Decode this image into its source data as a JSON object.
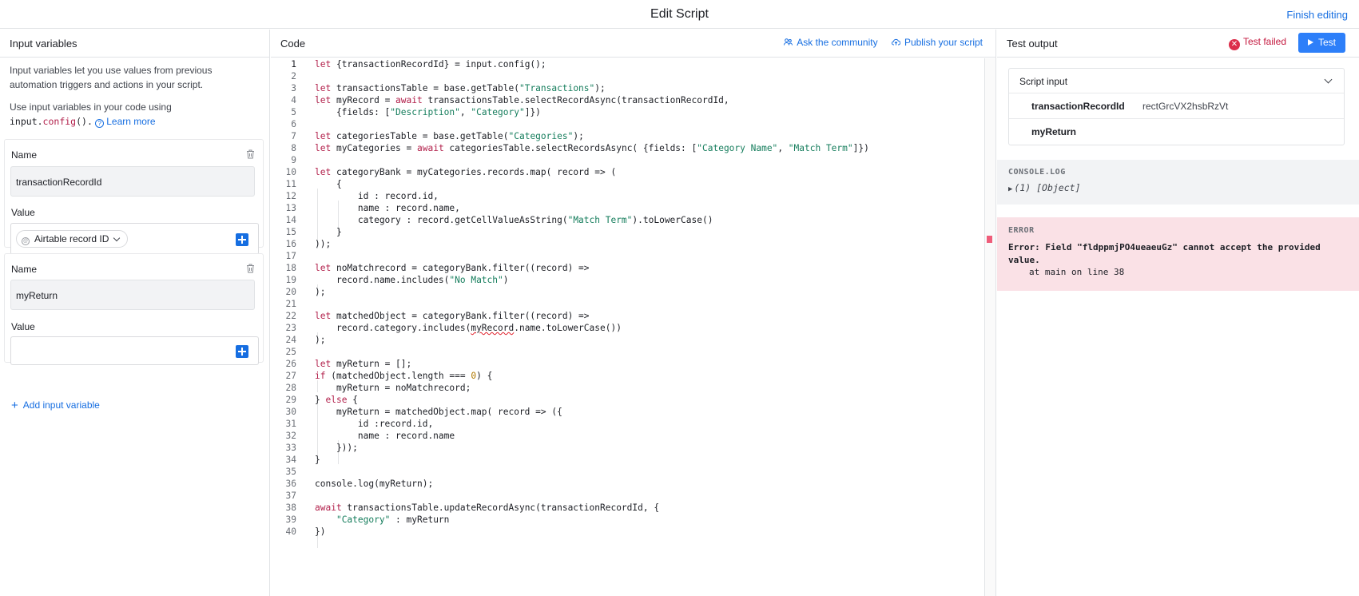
{
  "header": {
    "title": "Edit Script",
    "finish_label": "Finish editing"
  },
  "left": {
    "title": "Input variables",
    "intro1": "Input variables let you use values from previous automation triggers and actions in your script.",
    "intro2_prefix": "Use input variables in your code using",
    "intro2_code_a": "input.",
    "intro2_code_b": "config",
    "intro2_code_c": "().",
    "learn_more": "Learn more",
    "variables": [
      {
        "name_label": "Name",
        "name_value": "transactionRecordId",
        "value_label": "Value",
        "value_pill": "Airtable record ID"
      },
      {
        "name_label": "Name",
        "name_value": "myReturn",
        "value_label": "Value",
        "value_pill": ""
      }
    ],
    "add_variable": "Add input variable"
  },
  "code": {
    "title": "Code",
    "ask_label": "Ask the community",
    "publish_label": "Publish your script",
    "lines": [
      "let {transactionRecordId} = input.config();",
      "",
      "let transactionsTable = base.getTable(\"Transactions\");",
      "let myRecord = await transactionsTable.selectRecordAsync(transactionRecordId,",
      "    {fields: [\"Description\", \"Category\"]})",
      "",
      "let categoriesTable = base.getTable(\"Categories\");",
      "let myCategories = await categoriesTable.selectRecordsAsync( {fields: [\"Category Name\", \"Match Term\"]})",
      "",
      "let categoryBank = myCategories.records.map( record => (",
      "    {",
      "        id : record.id,",
      "        name : record.name,",
      "        category : record.getCellValueAsString(\"Match Term\").toLowerCase()",
      "    }",
      "));",
      "",
      "let noMatchrecord = categoryBank.filter((record) =>",
      "    record.name.includes(\"No Match\")",
      ");",
      "",
      "let matchedObject = categoryBank.filter((record) =>",
      "    record.category.includes(myRecord.name.toLowerCase())",
      ");",
      "",
      "let myReturn = [];",
      "if (matchedObject.length === 0) {",
      "    myReturn = noMatchrecord;",
      "} else {",
      "    myReturn = matchedObject.map( record => ({",
      "        id :record.id,",
      "        name : record.name",
      "    }));",
      "}",
      "",
      "console.log(myReturn);",
      "",
      "await transactionsTable.updateRecordAsync(transactionRecordId, {",
      "    \"Category\" : myReturn",
      "})"
    ],
    "active_line": 1
  },
  "output": {
    "title": "Test output",
    "status": "Test failed",
    "test_label": "Test",
    "script_input_title": "Script input",
    "script_inputs": [
      {
        "key": "transactionRecordId",
        "value": "rectGrcVX2hsbRzVt"
      },
      {
        "key": "myReturn",
        "value": ""
      }
    ],
    "console_title": "CONSOLE.LOG",
    "console_entry": "(1) [Object]",
    "error_title": "ERROR",
    "error_message": "Error: Field \"fldppmjPO4ueaeuGz\" cannot accept the provided value.",
    "error_location": "at main on line 38"
  },
  "colors": {
    "accent": "#166ee1",
    "button": "#2d7ff9",
    "error_bg": "#fae1e6",
    "fail": "#c4193f"
  }
}
